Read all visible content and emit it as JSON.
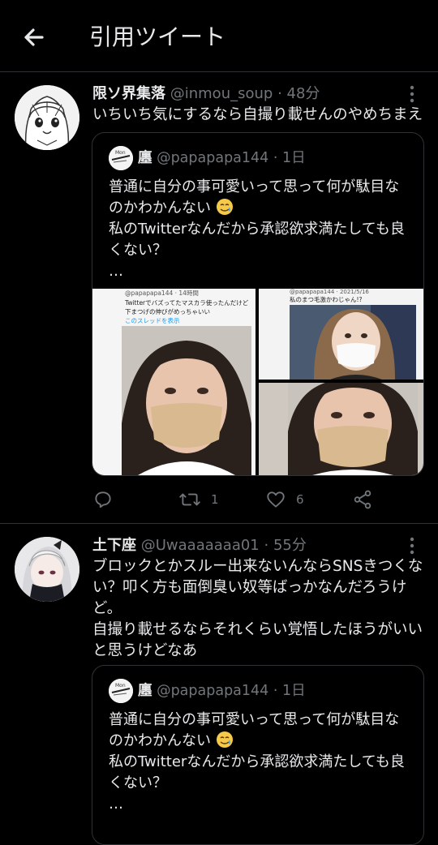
{
  "header": {
    "title": "引用ツイート",
    "back_icon": "arrow-left-icon"
  },
  "tweets": [
    {
      "author_name": "限ソ界集落",
      "handle": "@inmou_soup",
      "time": "48分",
      "text": [
        "いちいち気にするなら自撮り載せんのやめちまえ"
      ],
      "quote": {
        "author_name": "廛",
        "handle": "@papapapa144",
        "time": "1日",
        "lines": [
          "普通に自分の事可愛いって思って何が駄目な",
          "のかわかんない",
          "私のTwitterなんだから承認欲求満たしても良",
          "くない？",
          "…"
        ],
        "images": [
          {
            "header": "@papapapa144 · 14時間",
            "caption_1": "Twitterでバズってたマスカラ使ったんだけど",
            "caption_2": "下まつげの伸びがめっちゃいい",
            "thread_link": "このスレッドを表示"
          },
          {
            "header": "@papapapa144 · 2021/5/16",
            "caption_1": "私のまつ毛激かわじゃん!?"
          }
        ]
      },
      "actions": {
        "reply_count": "",
        "retweet_count": "1",
        "like_count": "6"
      }
    },
    {
      "author_name": "土下座",
      "handle": "@Uwaaaaaaa01",
      "time": "55分",
      "text": [
        "ブロックとかスルー出来ないんならSNSきつくな",
        "い？叩く方も面倒臭い奴等ばっかなんだろうけ",
        "ど。",
        "自撮り載せるならそれくらい覚悟したほうがいい",
        "と思うけどなあ"
      ],
      "quote": {
        "author_name": "廛",
        "handle": "@papapapa144",
        "time": "1日",
        "lines": [
          "普通に自分の事可愛いって思って何が駄目な",
          "のかわかんない",
          "私のTwitterなんだから承認欲求満たしても良",
          "くない？",
          "…"
        ]
      }
    }
  ],
  "colors": {
    "background": "#000000",
    "text": "#e7e9ea",
    "muted": "#71767b",
    "border": "#2f3336"
  }
}
